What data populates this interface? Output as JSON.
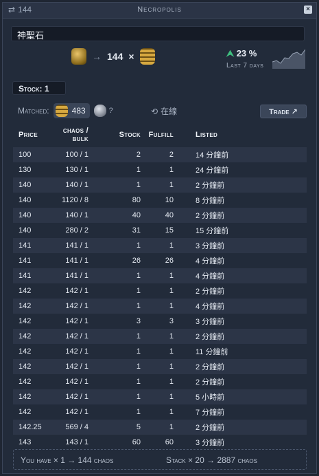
{
  "titlebar": {
    "count": "144",
    "title": "Necropolis"
  },
  "search": {
    "value": "神聖石"
  },
  "rate": {
    "amount": "144",
    "times": "×"
  },
  "trend": {
    "percent": "23 %",
    "label": "Last 7 days",
    "direction": "up",
    "color": "#3fbf7f"
  },
  "stock": {
    "label": "Stock:",
    "value": "1"
  },
  "matched": {
    "label": "Matched:",
    "count": "483",
    "question": "?",
    "online": "在線"
  },
  "trade": {
    "label": "Trade"
  },
  "table": {
    "headers": {
      "price": "Price",
      "bulk": "chaos / bulk",
      "stock": "Stock",
      "fulfill": "Fulfill",
      "listed": "Listed"
    },
    "rows": [
      [
        "100",
        "100 / 1",
        "2",
        "2",
        "14 分鐘前"
      ],
      [
        "130",
        "130 / 1",
        "1",
        "1",
        "24 分鐘前"
      ],
      [
        "140",
        "140 / 1",
        "1",
        "1",
        "2 分鐘前"
      ],
      [
        "140",
        "1120 / 8",
        "80",
        "10",
        "8 分鐘前"
      ],
      [
        "140",
        "140 / 1",
        "40",
        "40",
        "2 分鐘前"
      ],
      [
        "140",
        "280 / 2",
        "31",
        "15",
        "15 分鐘前"
      ],
      [
        "141",
        "141 / 1",
        "1",
        "1",
        "3 分鐘前"
      ],
      [
        "141",
        "141 / 1",
        "26",
        "26",
        "4 分鐘前"
      ],
      [
        "141",
        "141 / 1",
        "1",
        "1",
        "4 分鐘前"
      ],
      [
        "142",
        "142 / 1",
        "1",
        "1",
        "2 分鐘前"
      ],
      [
        "142",
        "142 / 1",
        "1",
        "1",
        "4 分鐘前"
      ],
      [
        "142",
        "142 / 1",
        "3",
        "3",
        "3 分鐘前"
      ],
      [
        "142",
        "142 / 1",
        "1",
        "1",
        "2 分鐘前"
      ],
      [
        "142",
        "142 / 1",
        "1",
        "1",
        "11 分鐘前"
      ],
      [
        "142",
        "142 / 1",
        "1",
        "1",
        "2 分鐘前"
      ],
      [
        "142",
        "142 / 1",
        "1",
        "1",
        "2 分鐘前"
      ],
      [
        "142",
        "142 / 1",
        "1",
        "1",
        "5 小時前"
      ],
      [
        "142",
        "142 / 1",
        "1",
        "1",
        "7 分鐘前"
      ],
      [
        "142.25",
        "569 / 4",
        "5",
        "1",
        "2 分鐘前"
      ],
      [
        "143",
        "143 / 1",
        "60",
        "60",
        "3 分鐘前"
      ]
    ]
  },
  "footer": {
    "have": "You have × 1 → 144 chaos",
    "stack": "Stack × 20 → 2887 chaos"
  }
}
